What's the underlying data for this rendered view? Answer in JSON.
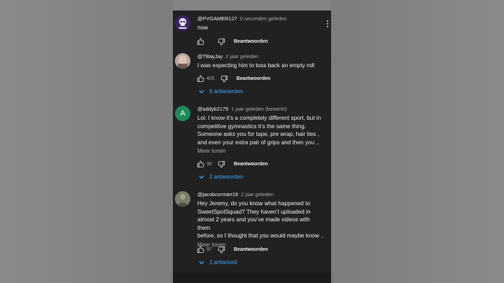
{
  "comments": [
    {
      "handle": "@PVGAMER127",
      "ago": "0 seconden geleden",
      "text": "now",
      "likes": "",
      "reply_label": "Beantwoorden",
      "avatar_color": "#4a2a7a"
    },
    {
      "handle": "@TBayJay",
      "ago": "2 jaar geleden",
      "text": "I was expecting him to toss back an empty roll",
      "likes": "405",
      "reply_label": "Beantwoorden",
      "replies": "6 antwoorden",
      "avatar_color": "#c8b8b0"
    },
    {
      "handle": "@addyb2179",
      "ago": "1 jaar geleden (bewerkt)",
      "lines": [
        "Lol. I know it’s a completely different sport, but in",
        "competitive gymnastics it’s the same thing.",
        "Someone asks you for tape, pre wrap, hair ties ,",
        "and even your extra pair of grips and then you .."
      ],
      "more": "Meer tonen",
      "likes": "30",
      "reply_label": "Beantwoorden",
      "replies": "2 antwoorden",
      "avatar_letter": "A",
      "avatar_color": "#1e8a5a"
    },
    {
      "handle": "@jacobcormier19",
      "ago": "2 jaar geleden",
      "lines": [
        "Hey Jeremy, do you know what happened to",
        "SweetSpotSquad? They haven’t uploaded in",
        "almost  2 years and you’ve made videos with them",
        "before, so I thought that you would maybe know .."
      ],
      "more": "Meer tonen",
      "likes": "97",
      "reply_label": "Beantwoorden",
      "replies": "1 antwoord",
      "avatar_color": "#6b6e5a"
    }
  ],
  "colors": {
    "panel": "#212121",
    "link": "#3ea6ff",
    "muted": "#aaaaaa"
  }
}
